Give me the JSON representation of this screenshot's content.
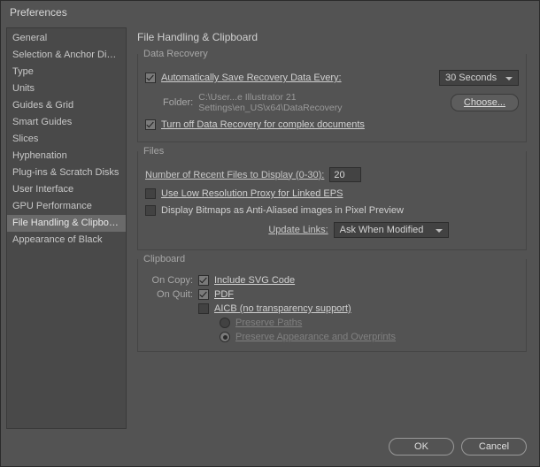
{
  "window": {
    "title": "Preferences"
  },
  "sidebar": {
    "items": [
      "General",
      "Selection & Anchor Display",
      "Type",
      "Units",
      "Guides & Grid",
      "Smart Guides",
      "Slices",
      "Hyphenation",
      "Plug-ins & Scratch Disks",
      "User Interface",
      "GPU Performance",
      "File Handling & Clipboard",
      "Appearance of Black"
    ],
    "selected_index": 11
  },
  "page": {
    "title": "File Handling & Clipboard"
  },
  "data_recovery": {
    "group_label": "Data Recovery",
    "auto_save_label": "Automatically Save Recovery Data Every:",
    "interval_value": "30 Seconds",
    "folder_label": "Folder:",
    "folder_path": "C:\\User...e Illustrator 21 Settings\\en_US\\x64\\DataRecovery",
    "choose_label": "Choose...",
    "turn_off_label": "Turn off Data Recovery for complex documents"
  },
  "files": {
    "group_label": "Files",
    "recent_label": "Number of Recent Files to Display (0-30):",
    "recent_value": "20",
    "low_res_label": "Use Low Resolution Proxy for Linked EPS",
    "bitmaps_label": "Display Bitmaps as Anti-Aliased images in Pixel Preview",
    "update_links_label": "Update Links:",
    "update_links_value": "Ask When Modified"
  },
  "clipboard": {
    "group_label": "Clipboard",
    "on_copy_label": "On Copy:",
    "include_svg_label": "Include SVG Code",
    "on_quit_label": "On Quit:",
    "pdf_label": "PDF",
    "aicb_label": "AICB (no transparency support)",
    "preserve_paths_label": "Preserve Paths",
    "preserve_appearance_label": "Preserve Appearance and Overprints"
  },
  "footer": {
    "ok": "OK",
    "cancel": "Cancel"
  }
}
